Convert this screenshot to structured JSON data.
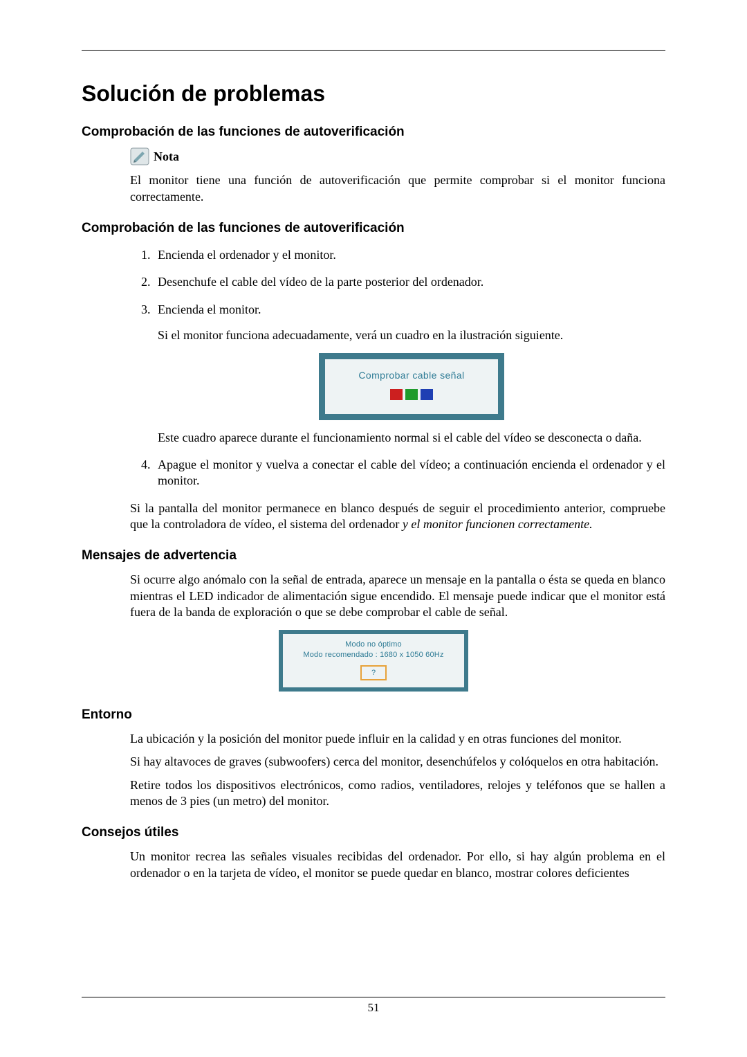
{
  "pageNumber": "51",
  "title": "Solución de problemas",
  "section_selftest_heading": "Comprobación de las funciones de autoverificación",
  "note_label": "Nota",
  "note_body": "El monitor tiene una función de autoverificación que permite comprobar si el monitor funciona correctamente.",
  "section_selftest_heading2": "Comprobación de las funciones de autoverificación",
  "steps": {
    "s1": "Encienda el ordenador y el monitor.",
    "s2": "Desenchufe el cable del vídeo de la parte posterior del ordenador.",
    "s3": "Encienda el monitor.",
    "s3_extra": "Si el monitor funciona adecuadamente, verá un cuadro en la ilustración siguiente.",
    "s3_after_fig": "Este cuadro aparece durante el funcionamiento normal si el cable del vídeo se desconecta o daña.",
    "s4": "Apague el monitor y vuelva a conectar el cable del vídeo; a continuación encienda el ordenador y el monitor."
  },
  "selftest_final": "Si la pantalla del monitor permanece en blanco después de seguir el procedimiento anterior, compruebe que la controladora de vídeo, el sistema del ordenador ",
  "selftest_final_italic": "y el monitor funcionen correctamente.",
  "section_warnings_heading": "Mensajes de advertencia",
  "warnings_body": "Si ocurre algo anómalo con la señal de entrada, aparece un mensaje en la pantalla o ésta se queda en blanco mientras el LED indicador de alimentación sigue encendido. El mensaje puede indicar que el monitor está fuera de la banda de exploración o que se debe comprobar el cable de señal.",
  "osd1_text": "Comprobar cable señal",
  "osd2_line1": "Modo no óptimo",
  "osd2_line2": "Modo recomendado : 1680 x 1050  60Hz",
  "osd2_btn": "?",
  "section_env_heading": "Entorno",
  "env_p1": "La ubicación y la posición del monitor puede influir en la calidad y en otras funciones del monitor.",
  "env_p2": "Si hay altavoces de graves (subwoofers) cerca del monitor, desenchúfelos y colóquelos en otra habitación.",
  "env_p3": "Retire todos los dispositivos electrónicos, como radios, ventiladores, relojes y teléfonos que se hallen a menos de 3 pies (un metro) del monitor.",
  "section_tips_heading": "Consejos útiles",
  "tips_p1": "Un monitor recrea las señales visuales recibidas del ordenador. Por ello, si hay algún problema en el ordenador o en la tarjeta de vídeo, el monitor se puede quedar en blanco, mostrar colores deficientes"
}
